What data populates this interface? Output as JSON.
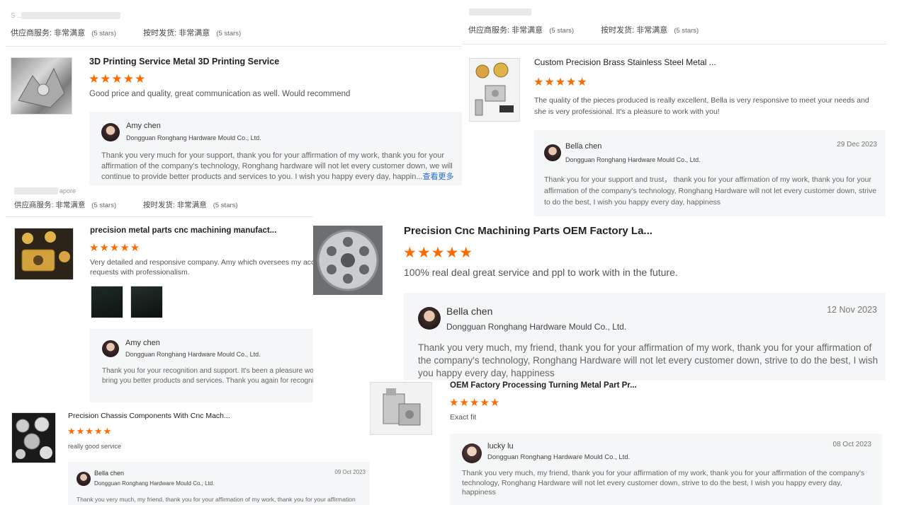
{
  "cards": {
    "c1": {
      "reviewer_fragment": "S ... s",
      "supplier_label": "供应商服务:",
      "supplier_value": "非常满意",
      "supplier_stars": "(5 stars)",
      "delivery_label": "按时发货:",
      "delivery_value": "非常满意",
      "delivery_stars": "(5 stars)",
      "product_title": "3D Printing Service Metal 3D Printing Service",
      "rating": "★★★★★",
      "comment": "Good price and quality, great communication as well. Would recommend",
      "reply": {
        "name": "Amy chen",
        "company": "Dongguan Ronghang Hardware Mould Co., Ltd.",
        "text": "Thank you very much for your support, thank you for your affirmation of my work, thank you for your affirmation of the company's technology, Ronghang hardware will not let every customer down, we will continue to provide better products and services to you. I wish you happy every day, happin...",
        "more": "查看更多"
      }
    },
    "c2": {
      "supplier_label": "供应商服务:",
      "supplier_value": "非常满意",
      "supplier_stars": "(5 stars)",
      "delivery_label": "按时发货:",
      "delivery_value": "非常满意",
      "delivery_stars": "(5 stars)",
      "product_title": "Custom Precision Brass Stainless Steel Metal ...",
      "rating": "★★★★★",
      "comment": "The quality of the pieces produced is really excellent, Bella is very responsive to meet your needs and she is very professional. It's a pleasure to work with you!",
      "reply": {
        "name": "Bella chen",
        "date": "29 Dec 2023",
        "company": "Dongguan Ronghang Hardware Mould Co., Ltd.",
        "text": "Thank you for your support and trust， thank you for your affirmation of my work, thank you for your affirmation of the company's technology, Ronghang Hardware will not let every customer down, strive to do the best, I wish you happy every day, happiness"
      }
    },
    "c3": {
      "reviewer_fragment": "apore",
      "supplier_label": "供应商服务:",
      "supplier_value": "非常满意",
      "supplier_stars": "(5 stars)",
      "delivery_label": "按时发货:",
      "delivery_value": "非常满意",
      "delivery_stars": "(5 stars)",
      "product_title": "precision metal parts cnc machining manufact...",
      "rating": "★★★★★",
      "comment": "Very detailed and responsive company. Amy which oversees my account handles my requests with professionalism.",
      "reply": {
        "name": "Amy chen",
        "company": "Dongguan Ronghang Hardware Mould Co., Ltd.",
        "text": "Thank you for your recognition and support. It's been a pleasure working with you. Ronghang will bring you better products and services. Thank you again for recognizing my work, my friend"
      }
    },
    "c4": {
      "product_title": "Precision Cnc Machining Parts OEM Factory La...",
      "rating": "★★★★★",
      "comment": "100% real deal great service and ppl to work with in the future.",
      "reply": {
        "name": "Bella chen",
        "date": "12 Nov 2023",
        "company": "Dongguan Ronghang Hardware Mould Co., Ltd.",
        "text": "Thank you very much, my friend, thank you for your affirmation of my work, thank you for your affirmation of the company's technology, Ronghang Hardware will not let every customer down, strive to do the best, I wish you happy every day, happiness"
      }
    },
    "c5": {
      "product_title": "Precision Chassis Components With Cnc Mach...",
      "rating": "★★★★★",
      "comment": "really good service",
      "reply": {
        "name": "Bella chen",
        "date": "09 Oct 2023",
        "company": "Dongguan Ronghang Hardware Mould Co., Ltd.",
        "text": "Thank you very much, my friend, thank you for your affirmation of my work, thank you for your affirmation"
      }
    },
    "c6": {
      "product_title": "OEM Factory Processing Turning Metal Part Pr...",
      "rating": "★★★★★",
      "comment": "Exact fit",
      "reply": {
        "name": "lucky lu",
        "date": "08 Oct 2023",
        "company": "Dongguan Ronghang Hardware Mould Co., Ltd.",
        "text": "Thank you very much, my friend, thank you for your affirmation of my work, thank you for your affirmation of the company's technology, Ronghang Hardware will not let every customer down, strive to do the best, I wish you happy every day, happiness"
      }
    }
  },
  "colors": {
    "star": "#ff6a00",
    "link": "#2266cc",
    "reply_bg": "#f5f6f7"
  },
  "icons": [
    "star-icon",
    "avatar",
    "product-thumbnail"
  ]
}
